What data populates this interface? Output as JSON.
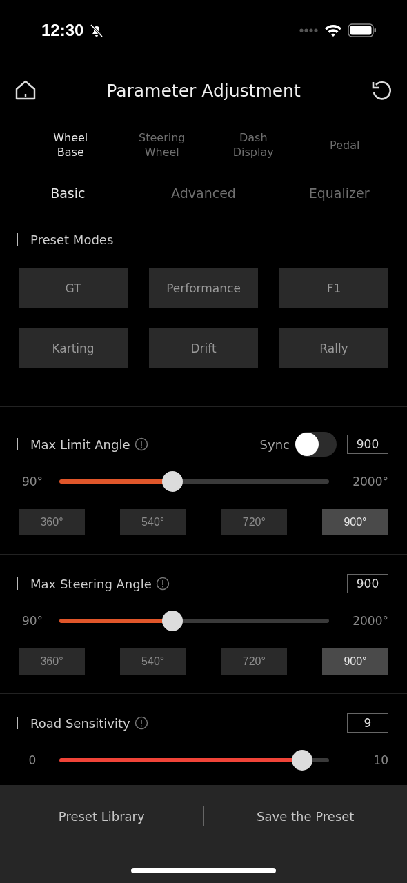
{
  "status_bar": {
    "time": "12:30"
  },
  "header": {
    "title": "Parameter Adjustment"
  },
  "device_tabs": [
    {
      "label": "Wheel Base",
      "selected": true
    },
    {
      "label": "Steering Wheel",
      "selected": false
    },
    {
      "label": "Dash Display",
      "selected": false
    },
    {
      "label": "Pedal",
      "selected": false
    }
  ],
  "sub_tabs": [
    {
      "label": "Basic",
      "selected": true
    },
    {
      "label": "Advanced",
      "selected": false
    },
    {
      "label": "Equalizer",
      "selected": false
    }
  ],
  "preset_modes": {
    "title": "Preset Modes",
    "buttons": [
      "GT",
      "Performance",
      "F1",
      "Karting",
      "Drift",
      "Rally"
    ]
  },
  "settings": [
    {
      "title": "Max Limit Angle",
      "sync": {
        "label": "Sync",
        "on": false
      },
      "value": "900",
      "min_label": "90°",
      "max_label": "2000°",
      "level": 0.42,
      "color": "#e0562a",
      "presets": [
        {
          "label": "360°",
          "selected": false
        },
        {
          "label": "540°",
          "selected": false
        },
        {
          "label": "720°",
          "selected": false
        },
        {
          "label": "900°",
          "selected": true
        }
      ]
    },
    {
      "title": "Max Steering Angle",
      "value": "900",
      "min_label": "90°",
      "max_label": "2000°",
      "level": 0.42,
      "color": "#e0562a",
      "presets": [
        {
          "label": "360°",
          "selected": false
        },
        {
          "label": "540°",
          "selected": false
        },
        {
          "label": "720°",
          "selected": false
        },
        {
          "label": "900°",
          "selected": true
        }
      ]
    },
    {
      "title": "Road Sensitivity",
      "value": "9",
      "min_label": "0",
      "max_label": "10",
      "level": 0.9,
      "color": "#f04438"
    }
  ],
  "footer": {
    "buttons": [
      "Preset Library",
      "Save the Preset"
    ]
  }
}
